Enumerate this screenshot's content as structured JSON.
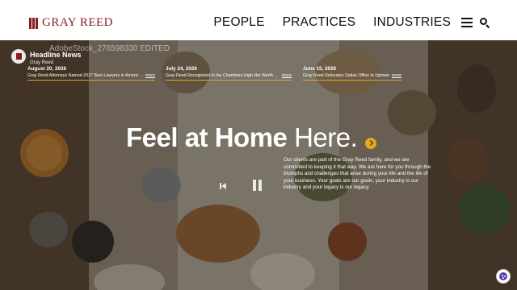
{
  "header": {
    "logo_text": "GRAY REED",
    "nav": [
      "PEOPLE",
      "PRACTICES",
      "INDUSTRIES"
    ]
  },
  "hero": {
    "watermark": "AdobeStock_276598330 EDITED",
    "news": {
      "title": "Headline News",
      "subtitle": "Gray Reed",
      "items": [
        {
          "date": "August 20, 2026",
          "text": "Gray Reed Attorneys Named 2027 Best Lawyers in Americ ...",
          "more": "more"
        },
        {
          "date": "July 24, 2026",
          "text": "Gray Reed Recognized in the Chambers High Net Worth ...",
          "more": "more"
        },
        {
          "date": "June 15, 2026",
          "text": "Gray Reed Relocates Dallas Office to Uptown",
          "more": "more"
        }
      ]
    },
    "headline_light": "Feel at Home ",
    "headline_bold": "Here.",
    "body": "Our clients are part of the Gray Reed family, and we are committed to keeping it that way. We are here for you through the triumphs and challenges that arise during your life and the life of your business. Your goals are our goals, your industry is our industry and your legacy is our legacy."
  },
  "colors": {
    "brand": "#8a1a1f",
    "accent": "#e0a920"
  }
}
